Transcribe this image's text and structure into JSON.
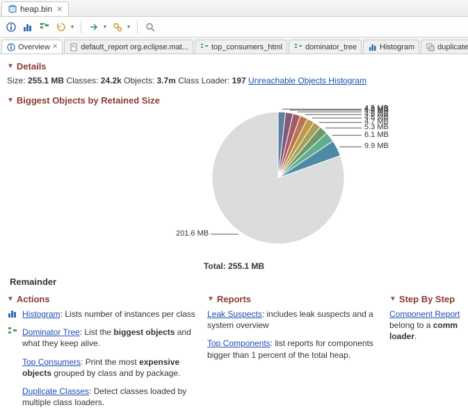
{
  "fileTab": {
    "name": "heap.bin"
  },
  "subtabs": [
    {
      "label": "Overview",
      "active": true,
      "icon": "info"
    },
    {
      "label": "default_report  org.eclipse.mat...",
      "active": false,
      "icon": "report"
    },
    {
      "label": "top_consumers_html",
      "active": false,
      "icon": "tree"
    },
    {
      "label": "dominator_tree",
      "active": false,
      "icon": "tree"
    },
    {
      "label": "Histogram",
      "active": false,
      "icon": "hist"
    },
    {
      "label": "duplicate_cl",
      "active": false,
      "icon": "dup"
    }
  ],
  "sections": {
    "details": "Details",
    "biggest": "Biggest Objects by Retained Size",
    "actions": "Actions",
    "reports": "Reports",
    "stepByStep": "Step By Step"
  },
  "details": {
    "sizeLabel": "Size:",
    "sizeValue": "255.1 MB",
    "classesLabel": "Classes:",
    "classesValue": "24.2k",
    "objectsLabel": "Objects:",
    "objectsValue": "3.7m",
    "classLoaderLabel": "Class Loader:",
    "classLoaderValue": "197",
    "unreachableLink": "Unreachable Objects Histogram"
  },
  "chart_data": {
    "type": "pie",
    "title": "Biggest Objects by Retained Size",
    "slices": [
      {
        "label": "201.6 MB",
        "value": 201.6,
        "color": "#dcdcdc"
      },
      {
        "label": "9.9 MB",
        "value": 9.9,
        "color": "#4e8aa6"
      },
      {
        "label": "6.1 MB",
        "value": 6.1,
        "color": "#5fae8e"
      },
      {
        "label": "5.3 MB",
        "value": 5.3,
        "color": "#6f9969"
      },
      {
        "label": "4.7 MB",
        "value": 4.7,
        "color": "#a8a056"
      },
      {
        "label": "4.6 MB",
        "value": 4.6,
        "color": "#c09848"
      },
      {
        "label": "4.6 MB",
        "value": 4.6,
        "color": "#b47752"
      },
      {
        "label": "4.6 MB",
        "value": 4.6,
        "color": "#a85a62"
      },
      {
        "label": "4.6 MB",
        "value": 4.6,
        "color": "#7f5a7d"
      },
      {
        "label": "4.5 MB",
        "value": 4.5,
        "color": "#5e7f9e"
      }
    ],
    "totalLabel": "Total:",
    "totalValue": "255.1 MB",
    "remainderLabel": "Remainder"
  },
  "actions": [
    {
      "link": "Histogram",
      "rest": ": Lists number of instances per class",
      "icon": "hist"
    },
    {
      "link": "Dominator Tree",
      "rest": ": List the ",
      "bold": "biggest objects",
      "tail": " and what they keep alive.",
      "icon": "tree"
    },
    {
      "link": "Top Consumers",
      "rest": ": Print the most ",
      "bold": "expensive objects",
      "tail": " grouped by class and by package.",
      "icon": "blank"
    },
    {
      "link": "Duplicate Classes",
      "rest": ": Detect classes loaded by multiple class loaders.",
      "icon": "blank"
    }
  ],
  "reports": [
    {
      "link": "Leak Suspects",
      "rest": ": includes leak suspects and a system overview"
    },
    {
      "link": "Top Components",
      "rest": ": list reports for components bigger than 1 percent of the total heap."
    }
  ],
  "step": {
    "link": "Component Report",
    "rest1": " belong to a ",
    "bold": "comm",
    "rest2": "loader",
    "tail": "."
  }
}
